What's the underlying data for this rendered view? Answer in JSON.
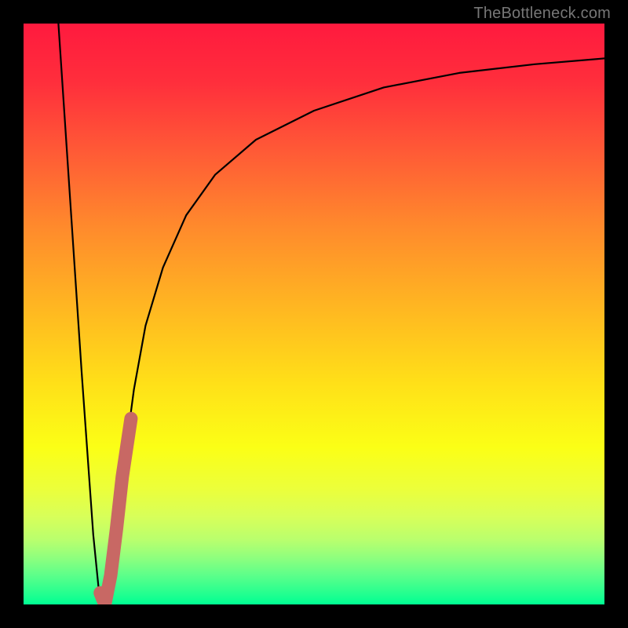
{
  "watermark": "TheBottleneck.com",
  "colors": {
    "curve": "#000000",
    "highlight": "#c86864",
    "frame_bg": "#000000"
  },
  "chart_data": {
    "type": "line",
    "title": "",
    "xlabel": "",
    "ylabel": "",
    "xlim": [
      0,
      100
    ],
    "ylim": [
      0,
      100
    ],
    "grid": false,
    "legend": false,
    "series": [
      {
        "name": "bottleneck-curve",
        "x": [
          6,
          8,
          10,
          12,
          13,
          14,
          15,
          17,
          19,
          21,
          24,
          28,
          33,
          40,
          50,
          62,
          75,
          88,
          100
        ],
        "y": [
          100,
          70,
          40,
          12,
          2,
          0,
          5,
          22,
          37,
          48,
          58,
          67,
          74,
          80,
          85,
          89,
          91.5,
          93,
          94
        ]
      },
      {
        "name": "highlight-segment",
        "x": [
          13.2,
          14,
          15,
          16,
          17,
          18.5
        ],
        "y": [
          2,
          0,
          5,
          13,
          22,
          32
        ]
      }
    ]
  }
}
